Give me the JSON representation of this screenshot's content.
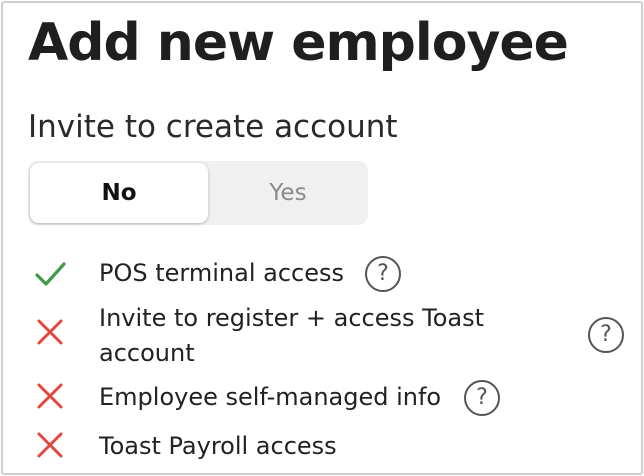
{
  "page": {
    "title": "Add new employee",
    "subtitle": "Invite to create account"
  },
  "toggle": {
    "options": [
      {
        "label": "No",
        "selected": true
      },
      {
        "label": "Yes",
        "selected": false
      }
    ]
  },
  "permissions": [
    {
      "label_line1": "POS terminal access",
      "label_line2": "",
      "status": "check-icon",
      "has_help": true
    },
    {
      "label_line1": "Invite to register + access Toast",
      "label_line2": "account",
      "status": "x-icon",
      "has_help": true
    },
    {
      "label_line1": "Employee self-managed info",
      "label_line2": "",
      "status": "x-icon",
      "has_help": true
    },
    {
      "label_line1": "Toast Payroll access",
      "label_line2": "",
      "status": "x-icon",
      "has_help": false
    }
  ],
  "icons": {
    "help_glyph": "?"
  },
  "colors": {
    "check": "#3f9a4a",
    "cross": "#e0473e",
    "toggle_track": "#f0f0f0"
  }
}
